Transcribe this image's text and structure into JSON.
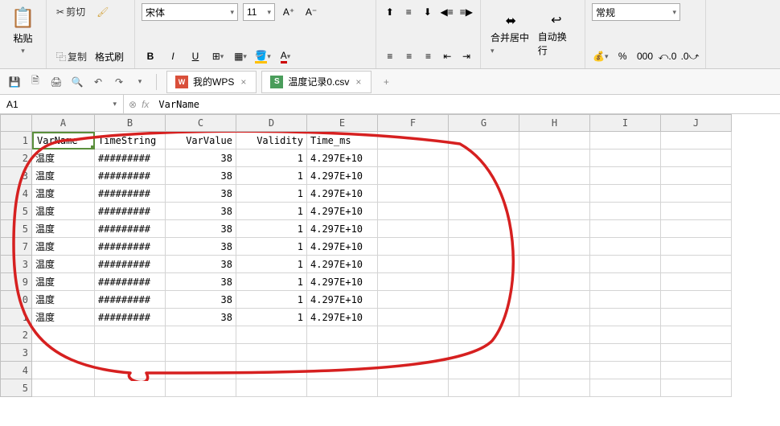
{
  "ribbon": {
    "cut": "剪切",
    "copy": "复制",
    "paste": "粘贴",
    "format_painter": "格式刷",
    "font_name": "宋体",
    "font_size": "11",
    "bold": "B",
    "italic": "I",
    "underline": "U",
    "merge_center": "合并居中",
    "wrap_text": "自动换行",
    "number_format": "常规"
  },
  "tabs": [
    {
      "icon": "wps",
      "label": "我的WPS"
    },
    {
      "icon": "xls",
      "label": "温度记录0.csv"
    }
  ],
  "namebox": "A1",
  "formula": "VarName",
  "columns": [
    "A",
    "B",
    "C",
    "D",
    "E",
    "F",
    "G",
    "H",
    "I",
    "J"
  ],
  "row_headers": [
    "1",
    "2",
    "3",
    "4",
    "5",
    "6",
    "7",
    "8",
    "9",
    "10",
    "11",
    "12",
    "13",
    "14",
    "15"
  ],
  "row_headers_display": [
    "1",
    "2",
    "3",
    "4",
    "5",
    "5",
    "7",
    "3",
    "9",
    "0",
    "1",
    "2",
    "3",
    "4",
    "5"
  ],
  "header_row": [
    "VarName",
    "TimeString",
    "VarValue",
    "Validity",
    "Time_ms"
  ],
  "data_rows": [
    [
      "温度",
      "#########",
      "38",
      "1",
      "4.297E+10"
    ],
    [
      "温度",
      "#########",
      "38",
      "1",
      "4.297E+10"
    ],
    [
      "温度",
      "#########",
      "38",
      "1",
      "4.297E+10"
    ],
    [
      "温度",
      "#########",
      "38",
      "1",
      "4.297E+10"
    ],
    [
      "温度",
      "#########",
      "38",
      "1",
      "4.297E+10"
    ],
    [
      "温度",
      "#########",
      "38",
      "1",
      "4.297E+10"
    ],
    [
      "温度",
      "#########",
      "38",
      "1",
      "4.297E+10"
    ],
    [
      "温度",
      "#########",
      "38",
      "1",
      "4.297E+10"
    ],
    [
      "温度",
      "#########",
      "38",
      "1",
      "4.297E+10"
    ],
    [
      "温度",
      "#########",
      "38",
      "1",
      "4.297E+10"
    ]
  ]
}
